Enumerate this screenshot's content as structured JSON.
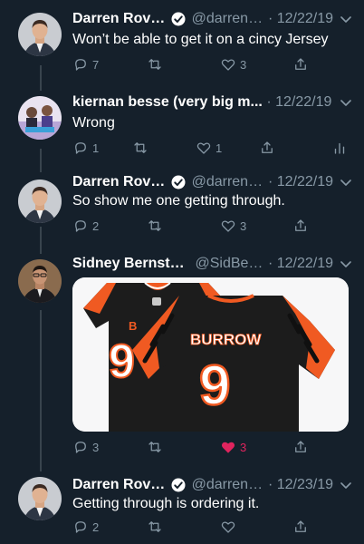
{
  "tweets": [
    {
      "name": "Darren Rovell",
      "handle": "@darrenr...",
      "separator": "·",
      "date": "12/22/19",
      "verified": true,
      "text": "Won’t be able to get it on a cincy Jersey",
      "replies": "7",
      "retweets": "",
      "likes": "3",
      "liked": false
    },
    {
      "name": "kiernan besse (very big m...",
      "handle": "",
      "separator": "·",
      "date": "12/22/19",
      "verified": false,
      "text": "Wrong",
      "replies": "1",
      "retweets": "",
      "likes": "1",
      "liked": false
    },
    {
      "name": "Darren Rovell",
      "handle": "@darrenr...",
      "separator": "·",
      "date": "12/22/19",
      "verified": true,
      "text": "So show me one getting through.",
      "replies": "2",
      "retweets": "",
      "likes": "3",
      "liked": false
    },
    {
      "name": "Sidney Bernstein",
      "handle": "@SidBer...",
      "separator": "·",
      "date": "12/22/19",
      "verified": false,
      "text": "",
      "media": {
        "jersey_name": "BURROW",
        "jersey_number": "9",
        "jersey_logo": "B",
        "jersey_colors": {
          "body": "#1c1c1c",
          "accent": "#f05a22",
          "stripe": "#101010"
        }
      },
      "replies": "3",
      "retweets": "",
      "likes": "3",
      "liked": true
    },
    {
      "name": "Darren Rovell",
      "handle": "@darrenr...",
      "separator": "·",
      "date": "12/23/19",
      "verified": true,
      "text": "Getting through is ordering it.",
      "replies": "2",
      "retweets": "",
      "likes": "",
      "liked": false
    }
  ],
  "colors": {
    "background": "#15202b",
    "secondary_text": "#8899a6",
    "verified_blue": "#1da1f2",
    "like_red": "#e0245e",
    "thread_line": "#38444d"
  },
  "icons": {
    "reply": "reply-icon",
    "retweet": "retweet-icon",
    "like": "heart-icon",
    "share": "share-icon",
    "analytics": "analytics-icon",
    "caret": "chevron-down-icon",
    "verified": "verified-badge-icon"
  }
}
